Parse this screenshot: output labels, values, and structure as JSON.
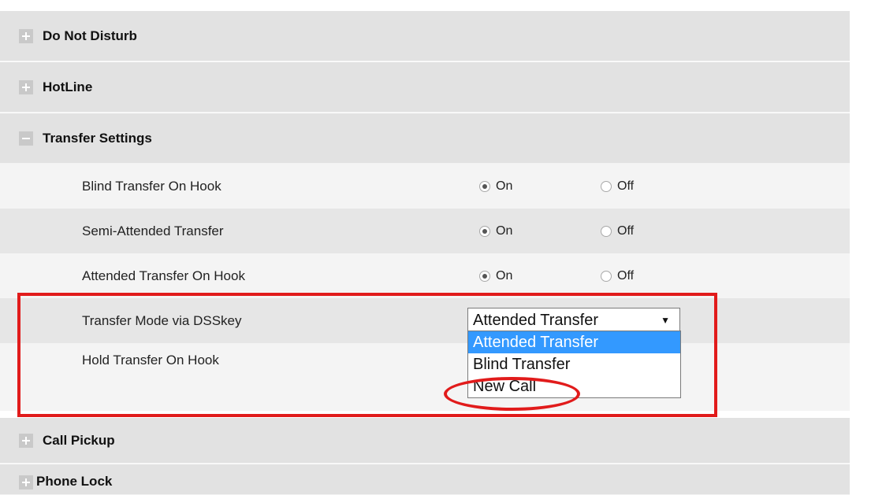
{
  "sections": {
    "do_not_disturb": "Do Not Disturb",
    "hotline": "HotLine",
    "transfer_settings": "Transfer Settings",
    "call_pickup": "Call Pickup",
    "phone_lock": "Phone Lock"
  },
  "transfer": {
    "rows": [
      {
        "label": "Blind Transfer On Hook",
        "on": "On",
        "off": "Off",
        "selected": "On"
      },
      {
        "label": "Semi-Attended Transfer",
        "on": "On",
        "off": "Off",
        "selected": "On"
      },
      {
        "label": "Attended Transfer On Hook",
        "on": "On",
        "off": "Off",
        "selected": "On"
      }
    ],
    "mode_label": "Transfer Mode via DSSkey",
    "mode_value": "Attended Transfer",
    "mode_options": [
      "Attended Transfer",
      "Blind Transfer",
      "New Call"
    ],
    "hold_label": "Hold Transfer On Hook"
  },
  "icons": {
    "expand": "plus-icon",
    "collapse": "minus-icon",
    "dropdown_arrow": "▼"
  },
  "colors": {
    "highlight": "#3399ff",
    "annotation": "#e11b1b"
  }
}
